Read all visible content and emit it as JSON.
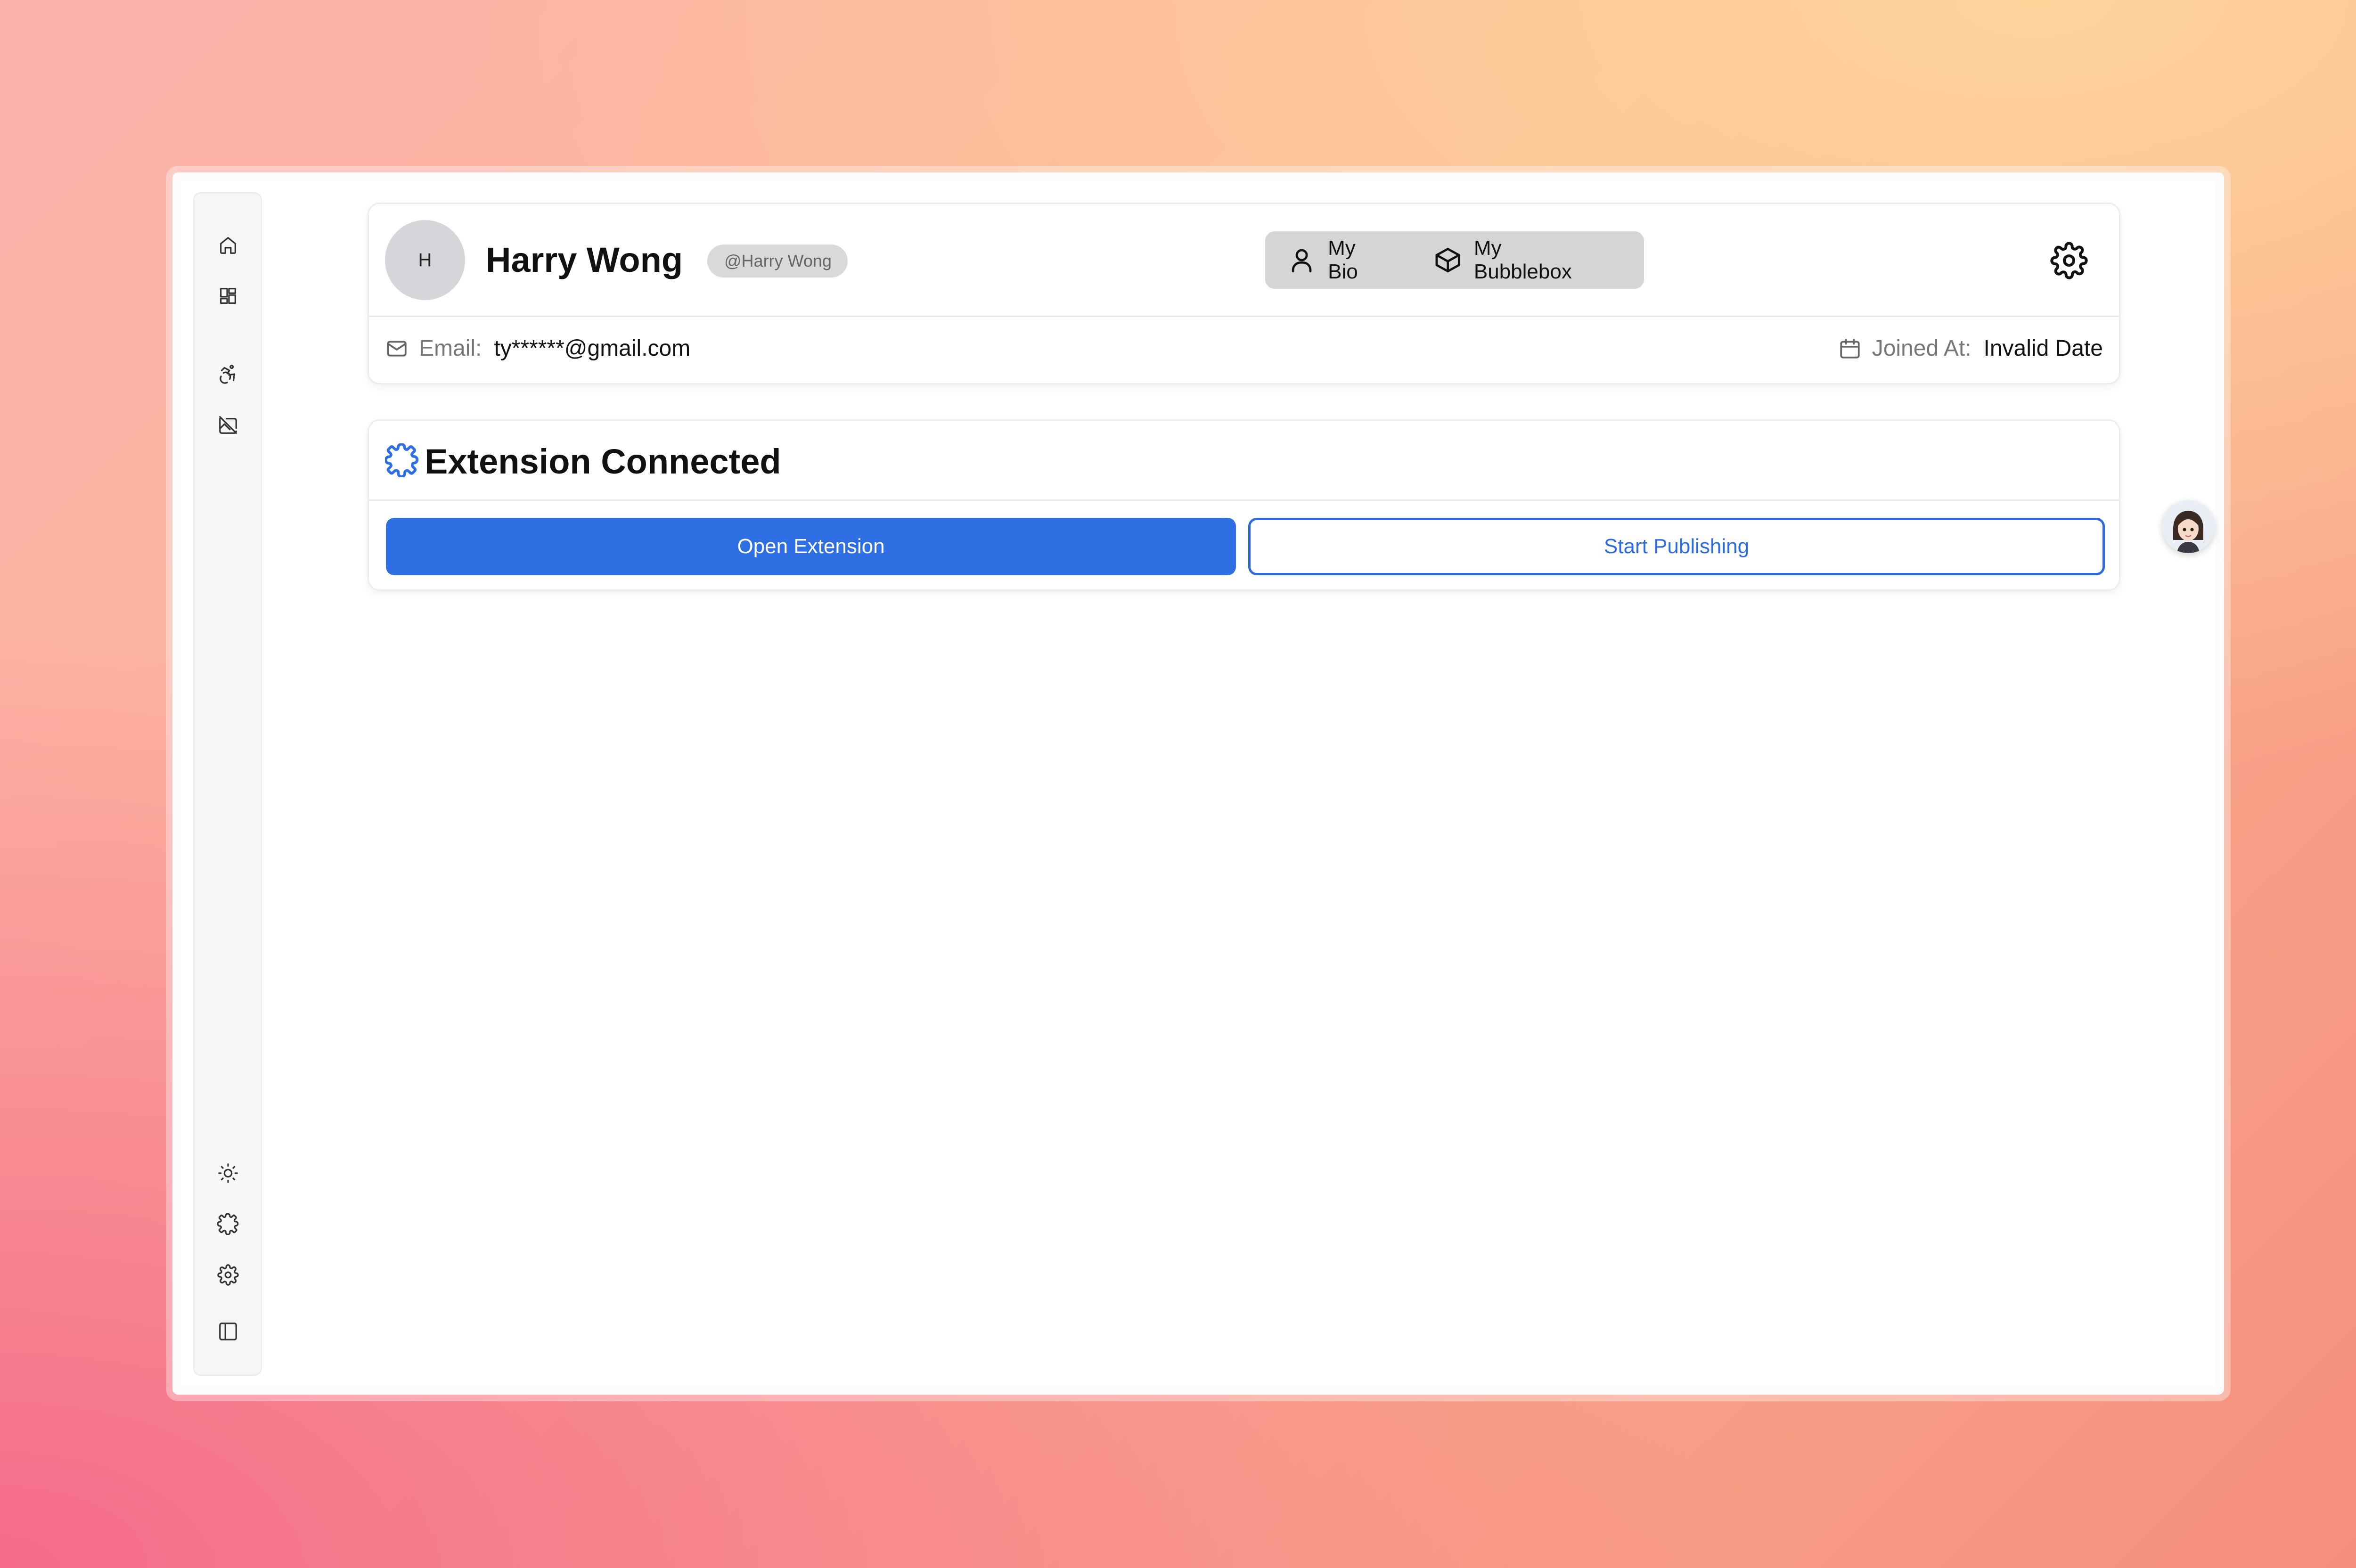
{
  "sidebar": {
    "top_icons": [
      "home-icon",
      "dashboard-icon",
      "accessibility-icon",
      "image-off-icon"
    ],
    "bottom_icons": [
      "sun-icon",
      "puzzle-icon",
      "settings-icon",
      "panel-left-icon"
    ]
  },
  "profile": {
    "avatar_initial": "H",
    "name": "Harry Wong",
    "handle": "@Harry Wong",
    "tabs": [
      {
        "label": "My Bio",
        "icon": "user-icon"
      },
      {
        "label": "My Bubblebox",
        "icon": "box-icon"
      }
    ],
    "email_label": "Email:",
    "email_value": "ty******@gmail.com",
    "joined_label": "Joined At:",
    "joined_value": "Invalid Date"
  },
  "extension": {
    "title": "Extension Connected",
    "open_button": "Open Extension",
    "publish_button": "Start Publishing"
  },
  "colors": {
    "accent": "#2f6fe4",
    "tab_bg": "#d5d5d8",
    "avatar_bg": "#d6d6da"
  }
}
